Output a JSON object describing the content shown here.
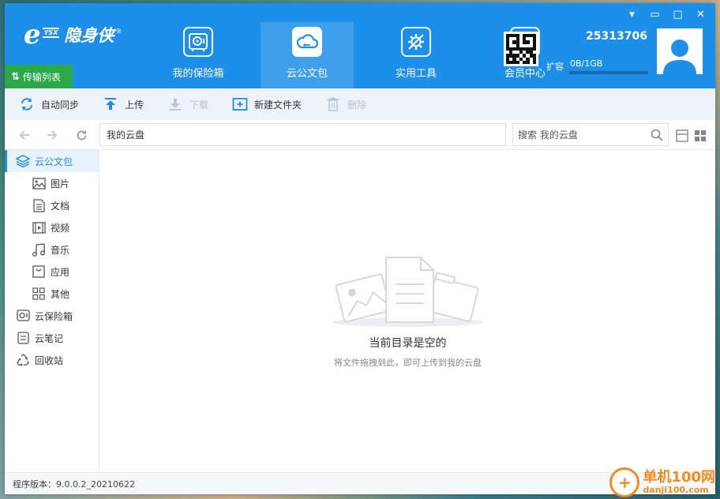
{
  "window_controls": {
    "pin": "▾",
    "minimize": "▭",
    "maximize": "□",
    "close": "✕"
  },
  "logo": {
    "e": "e",
    "ysx": "YSX",
    "name": "隐身侠",
    "reg": "®"
  },
  "transfer": {
    "arrows": "⇅",
    "label": "传输列表"
  },
  "nav_tabs": [
    {
      "label": "我的保险箱",
      "icon": "safe-icon"
    },
    {
      "label": "云公文包",
      "icon": "cloud-icon"
    },
    {
      "label": "实用工具",
      "icon": "tools-icon"
    },
    {
      "label": "会员中心",
      "icon": "yuan-icon"
    }
  ],
  "user": {
    "id": "25313706",
    "expand_label": "扩容",
    "quota": "0B/1GB",
    "quota_fraction": 0
  },
  "toolbar": {
    "auto_sync": "自动同步",
    "upload": "上传",
    "download": "下载",
    "new_folder": "新建文件夹",
    "delete": "删除"
  },
  "address": {
    "path": "我的云盘",
    "search_text": "搜索 我的云盘"
  },
  "sidebar": {
    "items": [
      {
        "label": "云公文包",
        "icon": "layers-icon"
      },
      {
        "label": "图片",
        "icon": "image-icon"
      },
      {
        "label": "文档",
        "icon": "document-icon"
      },
      {
        "label": "视频",
        "icon": "video-icon"
      },
      {
        "label": "音乐",
        "icon": "music-icon"
      },
      {
        "label": "应用",
        "icon": "app-icon"
      },
      {
        "label": "其他",
        "icon": "grid-icon"
      },
      {
        "label": "云保险箱",
        "icon": "safe-icon"
      },
      {
        "label": "云笔记",
        "icon": "note-icon"
      },
      {
        "label": "回收站",
        "icon": "recycle-icon"
      }
    ]
  },
  "empty": {
    "title": "当前目录是空的",
    "subtitle": "将文件拖拽到此，即可上传到我的云盘"
  },
  "status": {
    "version": "程序版本：9.0.0.2_20210622"
  },
  "watermark": {
    "line1": "单机100网",
    "line2": "danji100.com"
  },
  "colors": {
    "brand": "#1d8fe8",
    "transfer": "#2ba84a",
    "toolbar_bg": "#eef3f9",
    "active_bg": "#e8f2fc"
  }
}
